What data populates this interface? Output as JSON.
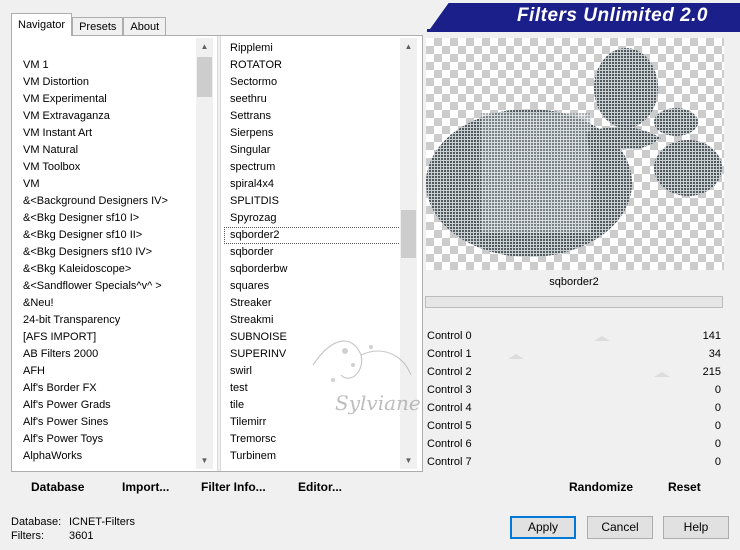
{
  "tabs": [
    {
      "label": "Navigator",
      "active": true
    },
    {
      "label": "Presets",
      "active": false
    },
    {
      "label": "About",
      "active": false
    }
  ],
  "banner": {
    "title": "Filters Unlimited 2.0"
  },
  "categories": [
    "VM 1",
    "VM Distortion",
    "VM Experimental",
    "VM Extravaganza",
    "VM Instant Art",
    "VM Natural",
    "VM Toolbox",
    "VM",
    "&<Background Designers IV>",
    "&<Bkg Designer sf10 I>",
    "&<Bkg Designer sf10 II>",
    "&<Bkg Designers sf10 IV>",
    "&<Bkg Kaleidoscope>",
    "&<Sandflower Specials^v^ >",
    "&Neu!",
    "24-bit Transparency",
    "[AFS IMPORT]",
    "AB Filters 2000",
    "AFH",
    "Alf's Border FX",
    "Alf's Power Grads",
    "Alf's Power Sines",
    "Alf's Power Toys",
    "AlphaWorks"
  ],
  "filters": [
    "Ripplemi",
    "ROTATOR",
    "Sectormo",
    "seethru",
    "Settrans",
    "Sierpens",
    "Singular",
    "spectrum",
    "spiral4x4",
    "SPLITDIS",
    "Spyrozag",
    "sqborder2",
    "sqborder",
    "sqborderbw",
    "squares",
    "Streaker",
    "Streakmi",
    "SUBNOISE",
    "SUPERINV",
    "swirl",
    "test",
    "tile",
    "Tilemirr",
    "Tremorsc",
    "Turbinem"
  ],
  "selected_filter": "sqborder2",
  "watermark": "Sylviane",
  "controls": [
    {
      "label": "Control 0",
      "value": 141
    },
    {
      "label": "Control 1",
      "value": 34
    },
    {
      "label": "Control 2",
      "value": 215
    },
    {
      "label": "Control 3",
      "value": 0
    },
    {
      "label": "Control 4",
      "value": 0
    },
    {
      "label": "Control 5",
      "value": 0
    },
    {
      "label": "Control 6",
      "value": 0
    },
    {
      "label": "Control 7",
      "value": 0
    }
  ],
  "bottom_buttons": {
    "database": "Database",
    "import": "Import...",
    "filter_info": "Filter Info...",
    "editor": "Editor...",
    "randomize": "Randomize",
    "reset": "Reset"
  },
  "status": {
    "database_label": "Database:",
    "database_value": "ICNET-Filters",
    "filters_label": "Filters:",
    "filters_value": "3601"
  },
  "dialog_buttons": {
    "apply": "Apply",
    "cancel": "Cancel",
    "help": "Help"
  },
  "icons": {
    "scroll_up": "chevron-up-icon",
    "scroll_down": "chevron-down-icon"
  }
}
